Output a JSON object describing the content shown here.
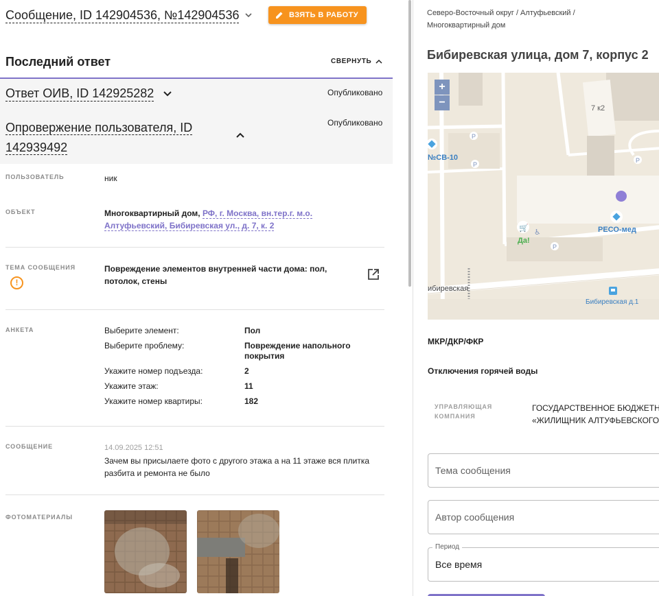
{
  "message": {
    "title": "Сообщение, ID 142904536, №142904536",
    "take_button": "ВЗЯТЬ В РАБОТУ"
  },
  "last_answer": {
    "heading": "Последний ответ",
    "collapse_label": "СВЕРНУТЬ"
  },
  "answers": [
    {
      "title": "Ответ ОИВ, ID 142925282",
      "status": "Опубликовано"
    },
    {
      "title": "Опровержение пользователя, ID 142939492",
      "status": "Опубликовано"
    }
  ],
  "fields": {
    "user_label": "ПОЛЬЗОВАТЕЛЬ",
    "user_value": "ник",
    "object_label": "ОБЪЕКТ",
    "object_type": "Многоквартирный дом,",
    "object_link_1": "РФ, г. Москва, вн.тер.г. м.о.",
    "object_link_2": "Алтуфьевский, Бибиревская ул., д. 7, к. 2",
    "topic_label": "ТЕМА СООБЩЕНИЯ",
    "topic_line_1": "Повреждение элементов внутренней части дома: пол,",
    "topic_line_2": "потолок, стены",
    "survey_label": "АНКЕТА",
    "message_label": "СООБЩЕНИЕ",
    "message_date": "14.09.2025 12:51",
    "message_line_1": "Зачем вы присылаете фото с другого этажа а на 11 этаже вся плитка",
    "message_line_2": "разбита и ремонта не было",
    "photos_label": "ФОТОМАТЕРИАЛЫ"
  },
  "survey": [
    {
      "q": "Выберите элемент:",
      "a": "Пол"
    },
    {
      "q": "Выберите проблему:",
      "a": "Повреждение напольного покрытия"
    },
    {
      "q": "Укажите номер подъезда:",
      "a": "2"
    },
    {
      "q": "Укажите этаж:",
      "a": "11"
    },
    {
      "q": "Укажите номер квартиры:",
      "a": "182"
    }
  ],
  "right": {
    "breadcrumb_1": "Северо-Восточный округ / Алтуфьевский /",
    "breadcrumb_2": "Многоквартирный дом",
    "address": "Бибиревская улица, дом 7, корпус 2",
    "map": {
      "zoom_in": "+",
      "zoom_out": "−",
      "building_label": "7 к2",
      "station_label": "№СВ-10",
      "poi_reso": "РЕСО-мед",
      "poi_da": "Да!",
      "street": "ибиревская",
      "bus_stop": "Бибиревская д.1",
      "parking": "P"
    },
    "mkr": "МКР/ДКР/ФКР",
    "hot_water": "Отключения горячей воды",
    "uk_label": "УПРАВЛЯЮЩАЯ КОМПАНИЯ",
    "uk_line_1": "ГОСУДАРСТВЕННОЕ БЮДЖЕТНО",
    "uk_line_2": "«ЖИЛИЩНИК АЛТУФЬЕВСКОГО",
    "topic_placeholder": "Тема сообщения",
    "author_placeholder": "Автор сообщения",
    "period_label": "Период",
    "period_value": "Все время"
  },
  "colors": {
    "accent_orange": "#f7931e",
    "accent_purple": "#7e72c8",
    "zoom_blue": "#7e94bd"
  }
}
